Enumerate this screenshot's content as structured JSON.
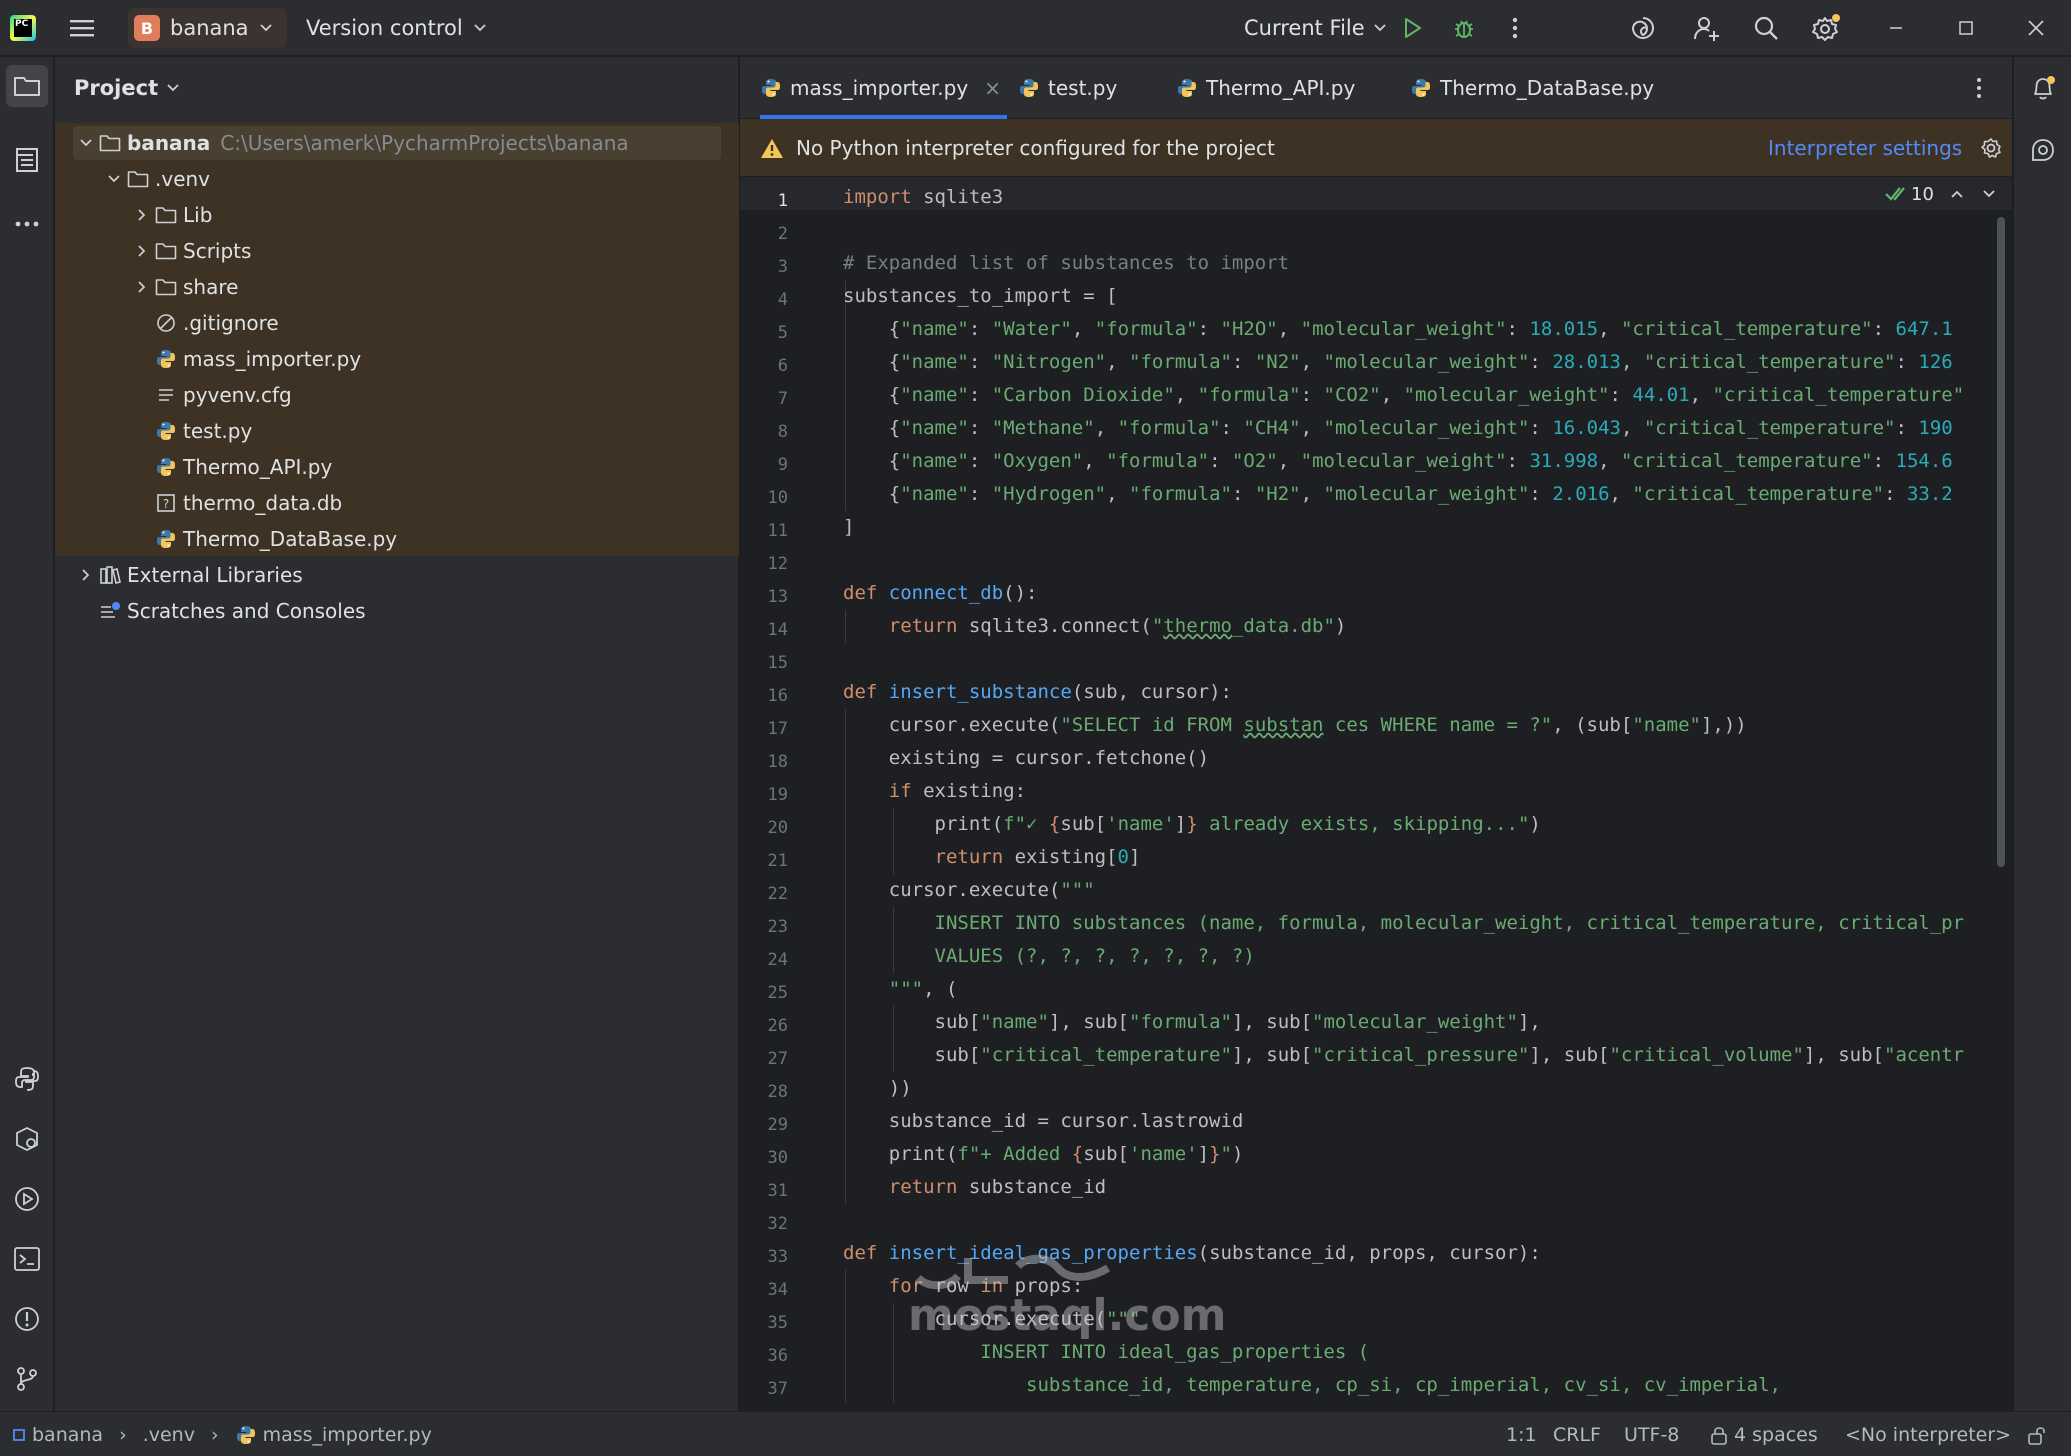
{
  "titlebar": {
    "project_initial": "B",
    "project_name": "banana",
    "vcs_label": "Version control",
    "run_config": "Current File"
  },
  "project_panel": {
    "title": "Project",
    "tree": [
      {
        "label": "banana",
        "path": "C:\\Users\\amerk\\PycharmProjects\\banana",
        "type": "folder",
        "expanded": true,
        "depth": 0
      },
      {
        "label": ".venv",
        "type": "folder",
        "expanded": true,
        "depth": 1
      },
      {
        "label": "Lib",
        "type": "folder",
        "expanded": false,
        "depth": 2
      },
      {
        "label": "Scripts",
        "type": "folder",
        "expanded": false,
        "depth": 2
      },
      {
        "label": "share",
        "type": "folder",
        "expanded": false,
        "depth": 2
      },
      {
        "label": ".gitignore",
        "type": "ignore-file",
        "depth": 2
      },
      {
        "label": "mass_importer.py",
        "type": "python-file",
        "depth": 2
      },
      {
        "label": "pyvenv.cfg",
        "type": "text-file",
        "depth": 2
      },
      {
        "label": "test.py",
        "type": "python-file",
        "depth": 2
      },
      {
        "label": "Thermo_API.py",
        "type": "python-file",
        "depth": 2
      },
      {
        "label": "thermo_data.db",
        "type": "unknown-file",
        "depth": 2
      },
      {
        "label": "Thermo_DataBase.py",
        "type": "python-file",
        "depth": 2
      },
      {
        "label": "External Libraries",
        "type": "library",
        "expanded": false,
        "depth": 0
      },
      {
        "label": "Scratches and Consoles",
        "type": "scratches",
        "depth": 0
      }
    ]
  },
  "editor": {
    "tabs": [
      {
        "label": "mass_importer.py",
        "active": true
      },
      {
        "label": "test.py",
        "active": false
      },
      {
        "label": "Thermo_API.py",
        "active": false
      },
      {
        "label": "Thermo_DataBase.py",
        "active": false
      }
    ],
    "banner": {
      "message": "No Python interpreter configured for the project",
      "link": "Interpreter settings"
    },
    "inspection_count": "10",
    "current_line": 1,
    "lines": [
      "<span class=\"kw\">import</span> sqlite3",
      "",
      "<span class=\"cmt\"># Expanded list of substances to import</span>",
      "substances_to_import = [",
      "    {<span class=\"str\">\"name\"</span>: <span class=\"str\">\"Water\"</span>, <span class=\"str\">\"formula\"</span>: <span class=\"str\">\"H2O\"</span>, <span class=\"str\">\"molecular_weight\"</span>: <span class=\"num\">18.015</span>, <span class=\"str\">\"critical_temperature\"</span>: <span class=\"num\">647.1</span>",
      "    {<span class=\"str\">\"name\"</span>: <span class=\"str\">\"Nitrogen\"</span>, <span class=\"str\">\"formula\"</span>: <span class=\"str\">\"N2\"</span>, <span class=\"str\">\"molecular_weight\"</span>: <span class=\"num\">28.013</span>, <span class=\"str\">\"critical_temperature\"</span>: <span class=\"num\">126</span>",
      "    {<span class=\"str\">\"name\"</span>: <span class=\"str\">\"Carbon Dioxide\"</span>, <span class=\"str\">\"formula\"</span>: <span class=\"str\">\"CO2\"</span>, <span class=\"str\">\"molecular_weight\"</span>: <span class=\"num\">44.01</span>, <span class=\"str\">\"critical_temperature\"</span>",
      "    {<span class=\"str\">\"name\"</span>: <span class=\"str\">\"Methane\"</span>, <span class=\"str\">\"formula\"</span>: <span class=\"str\">\"CH4\"</span>, <span class=\"str\">\"molecular_weight\"</span>: <span class=\"num\">16.043</span>, <span class=\"str\">\"critical_temperature\"</span>: <span class=\"num\">190</span>",
      "    {<span class=\"str\">\"name\"</span>: <span class=\"str\">\"Oxygen\"</span>, <span class=\"str\">\"formula\"</span>: <span class=\"str\">\"O2\"</span>, <span class=\"str\">\"molecular_weight\"</span>: <span class=\"num\">31.998</span>, <span class=\"str\">\"critical_temperature\"</span>: <span class=\"num\">154.6</span>",
      "    {<span class=\"str\">\"name\"</span>: <span class=\"str\">\"Hydrogen\"</span>, <span class=\"str\">\"formula\"</span>: <span class=\"str\">\"H2\"</span>, <span class=\"str\">\"molecular_weight\"</span>: <span class=\"num\">2.016</span>, <span class=\"str\">\"critical_temperature\"</span>: <span class=\"num\">33.2</span>",
      "]",
      "",
      "<span class=\"kw\">def</span> <span class=\"fn\">connect_db</span>():",
      "    <span class=\"kw\">return</span> sqlite3.connect(<span class=\"str\">\"<span class=\"under\">thermo</span>_data.db\"</span>)",
      "",
      "<span class=\"kw\">def</span> <span class=\"fn\">insert_substance</span>(sub, cursor):",
      "    cursor.execute(<span class=\"str\">\"SELECT id FROM <span class=\"under\">substan</span> ces WHERE name = ?\"</span>, (sub[<span class=\"str\">\"name\"</span>],))",
      "    existing = cursor.fetchone()",
      "    <span class=\"kw\">if</span> existing:",
      "        print(<span class=\"str\">f\"✓ </span><span class=\"kw\">{</span>sub[<span class=\"str\">'name'</span>]<span class=\"kw\">}</span><span class=\"str\"> already exists, skipping...\"</span>)",
      "        <span class=\"kw\">return</span> existing[<span class=\"num\">0</span>]",
      "    cursor.execute(<span class=\"str\">\"\"\"</span>",
      "<span class=\"str\">        INSERT INTO substances (name, formula, molecular_weight, critical_temperature, critical_pr</span>",
      "<span class=\"str\">        VALUES (?, ?, ?, ?, ?, ?, ?)</span>",
      "<span class=\"str\">    \"\"\"</span>, (",
      "        sub[<span class=\"str\">\"name\"</span>], sub[<span class=\"str\">\"formula\"</span>], sub[<span class=\"str\">\"molecular_weight\"</span>],",
      "        sub[<span class=\"str\">\"critical_temperature\"</span>], sub[<span class=\"str\">\"critical_pressure\"</span>], sub[<span class=\"str\">\"critical_volume\"</span>], sub[<span class=\"str\">\"acentr</span>",
      "    ))",
      "    substance_id = cursor.lastrowid",
      "    print(<span class=\"str\">f\"+ Added </span><span class=\"kw\">{</span>sub[<span class=\"str\">'name'</span>]<span class=\"kw\">}</span><span class=\"str\">\"</span>)",
      "    <span class=\"kw\">return</span> substance_id",
      "",
      "<span class=\"kw\">def</span> <span class=\"fn\">insert_ideal_gas_properties</span>(substance_id, props, cursor):",
      "    <span class=\"kw\">for</span> row <span class=\"kw\">in</span> props:",
      "        cursor.execute(<span class=\"str\">\"\"\"</span>",
      "<span class=\"str\">            INSERT INTO ideal_gas_properties (</span>",
      "<span class=\"str\">                substance_id, temperature, cp_si, cp_imperial, cv_si, cv_imperial,</span>"
    ]
  },
  "statusbar": {
    "breadcrumb": [
      "banana",
      ".venv",
      "mass_importer.py"
    ],
    "position": "1:1",
    "line_sep": "CRLF",
    "encoding": "UTF-8",
    "indent": "4 spaces",
    "interpreter": "<No interpreter>"
  },
  "watermark": "mostaql.com",
  "colors": {
    "accent": "#3574f0",
    "keyword": "#cf8e6d",
    "string": "#6aab73",
    "number": "#2aacb8",
    "function": "#56a8f5",
    "comment": "#7a7e85",
    "banner_bg": "#3d3223",
    "run_green": "#5fb865"
  }
}
